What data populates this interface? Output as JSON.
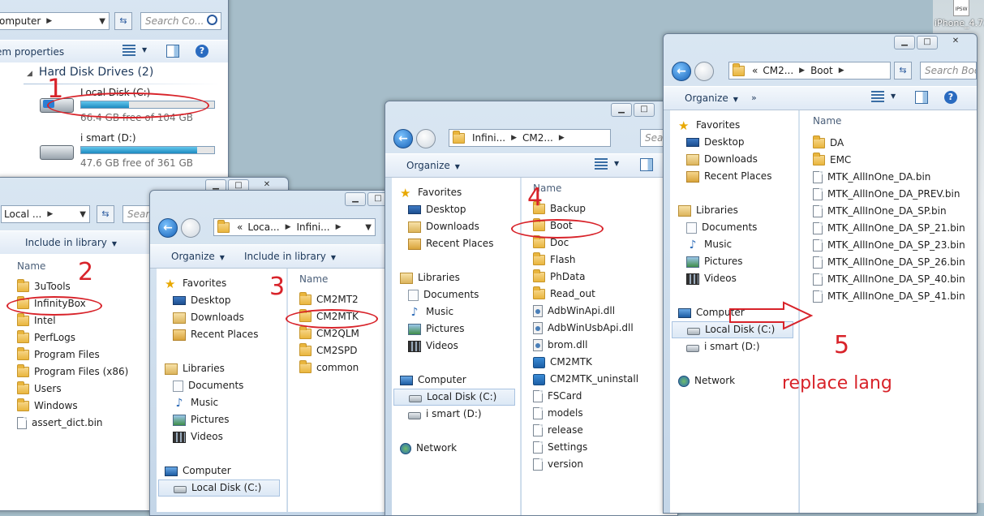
{
  "w1": {
    "address": "omputer",
    "search": "Search Co...",
    "toolbar_label": "em properties",
    "group": "Hard Disk Drives (2)",
    "drives": [
      {
        "name": "Local Disk (C:)",
        "free": "66.4 GB free of 104 GB",
        "used": 0.36
      },
      {
        "name": "i smart (D:)",
        "free": "47.6 GB free of 361 GB",
        "used": 0.87
      }
    ],
    "annotation": "1"
  },
  "w2": {
    "address": "Local ...",
    "search": "Searc",
    "toolbar": [
      "Include in library"
    ],
    "col_name": "Name",
    "files": [
      "3uTools",
      "InfinityBox",
      "Intel",
      "PerfLogs",
      "Program Files",
      "Program Files (x86)",
      "Users",
      "Windows",
      "assert_dict.bin"
    ],
    "annotation": "2"
  },
  "w3": {
    "address": [
      "«",
      "Loca...",
      "Infini..."
    ],
    "toolbar": [
      "Organize",
      "Include in library"
    ],
    "nav": {
      "favorites": "Favorites",
      "fav_items": [
        "Desktop",
        "Downloads",
        "Recent Places"
      ],
      "libraries": "Libraries",
      "lib_items": [
        "Documents",
        "Music",
        "Pictures",
        "Videos"
      ],
      "computer": "Computer",
      "comp_items": [
        "Local Disk (C:)"
      ]
    },
    "col_name": "Name",
    "files": [
      "CM2MT2",
      "CM2MTK",
      "CM2QLM",
      "CM2SPD",
      "common"
    ],
    "annotation": "3"
  },
  "w4": {
    "address": [
      "Infini...",
      "CM2..."
    ],
    "search": "Sear",
    "toolbar": [
      "Organize"
    ],
    "nav": {
      "favorites": "Favorites",
      "fav_items": [
        "Desktop",
        "Downloads",
        "Recent Places"
      ],
      "libraries": "Libraries",
      "lib_items": [
        "Documents",
        "Music",
        "Pictures",
        "Videos"
      ],
      "computer": "Computer",
      "comp_items": [
        "Local Disk (C:)",
        "i smart (D:)"
      ],
      "network": "Network"
    },
    "col_name": "Name",
    "files": [
      {
        "name": "Backup",
        "type": "folder"
      },
      {
        "name": "Boot",
        "type": "folder"
      },
      {
        "name": "Doc",
        "type": "folder"
      },
      {
        "name": "Flash",
        "type": "folder"
      },
      {
        "name": "PhData",
        "type": "folder"
      },
      {
        "name": "Read_out",
        "type": "folder"
      },
      {
        "name": "AdbWinApi.dll",
        "type": "dll"
      },
      {
        "name": "AdbWinUsbApi.dll",
        "type": "dll"
      },
      {
        "name": "brom.dll",
        "type": "dll"
      },
      {
        "name": "CM2MTK",
        "type": "exe"
      },
      {
        "name": "CM2MTK_uninstall",
        "type": "exe"
      },
      {
        "name": "FSCard",
        "type": "file"
      },
      {
        "name": "models",
        "type": "file"
      },
      {
        "name": "release",
        "type": "file"
      },
      {
        "name": "Settings",
        "type": "file"
      },
      {
        "name": "version",
        "type": "file"
      }
    ],
    "annotation": "4"
  },
  "w5": {
    "address": [
      "«",
      "CM2...",
      "Boot"
    ],
    "search": "Search Boo",
    "toolbar": [
      "Organize"
    ],
    "nav": {
      "favorites": "Favorites",
      "fav_items": [
        "Desktop",
        "Downloads",
        "Recent Places"
      ],
      "libraries": "Libraries",
      "lib_items": [
        "Documents",
        "Music",
        "Pictures",
        "Videos"
      ],
      "computer": "Computer",
      "comp_items": [
        "Local Disk (C:)",
        "i smart (D:)"
      ],
      "network": "Network"
    },
    "col_name": "Name",
    "files": [
      {
        "name": "DA",
        "type": "folder"
      },
      {
        "name": "EMC",
        "type": "folder"
      },
      {
        "name": "MTK_AllInOne_DA.bin",
        "type": "file"
      },
      {
        "name": "MTK_AllInOne_DA_PREV.bin",
        "type": "file"
      },
      {
        "name": "MTK_AllInOne_DA_SP.bin",
        "type": "file"
      },
      {
        "name": "MTK_AllInOne_DA_SP_21.bin",
        "type": "file"
      },
      {
        "name": "MTK_AllInOne_DA_SP_23.bin",
        "type": "file"
      },
      {
        "name": "MTK_AllInOne_DA_SP_26.bin",
        "type": "file"
      },
      {
        "name": "MTK_AllInOne_DA_SP_40.bin",
        "type": "file"
      },
      {
        "name": "MTK_AllInOne_DA_SP_41.bin",
        "type": "file"
      }
    ],
    "annotation_num": "5",
    "annotation_text": "replace lang"
  },
  "desktop": {
    "icon_label": "iPhone_4.7...",
    "icon_badge": "IPSW"
  }
}
